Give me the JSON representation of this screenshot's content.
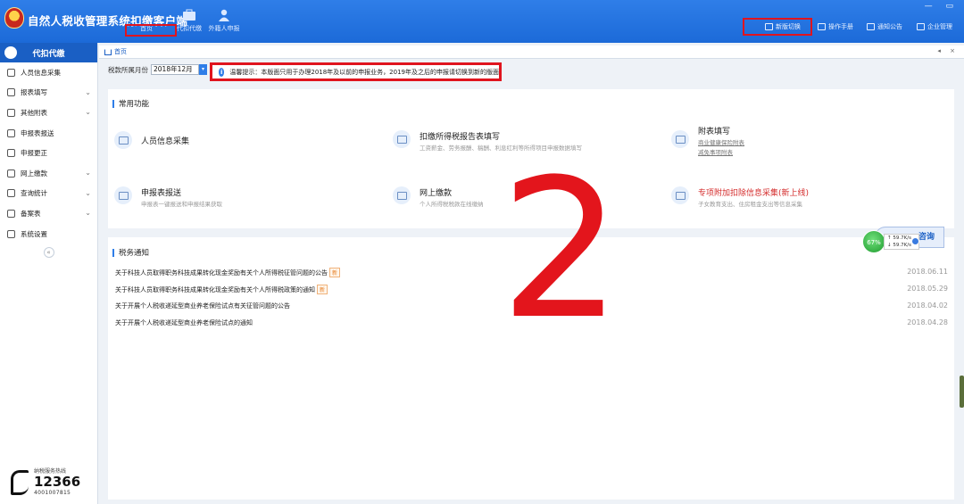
{
  "header": {
    "title": "自然人税收管理系统扣缴客户端",
    "nav": [
      {
        "label": "首页"
      },
      {
        "label": "代扣代缴"
      },
      {
        "label": "外籍人申报"
      }
    ],
    "buttons": [
      {
        "label": "新版切换"
      },
      {
        "label": "操作手册"
      },
      {
        "label": "通知公告"
      },
      {
        "label": "企业管理"
      }
    ],
    "window_controls": "— ▭"
  },
  "sidebar": {
    "title": "代扣代缴",
    "items": [
      {
        "label": "人员信息采集",
        "chevron": ""
      },
      {
        "label": "报表填写",
        "chevron": "⌄"
      },
      {
        "label": "其他附表",
        "chevron": "⌄"
      },
      {
        "label": "申报表报送",
        "chevron": ""
      },
      {
        "label": "申报更正",
        "chevron": ""
      },
      {
        "label": "网上缴款",
        "chevron": "⌄"
      },
      {
        "label": "查询统计",
        "chevron": "⌄"
      },
      {
        "label": "备案表",
        "chevron": "⌄"
      },
      {
        "label": "系统设置",
        "chevron": ""
      }
    ],
    "collapse": "«",
    "hotline": {
      "caption": "纳税服务热线",
      "number": "12366",
      "sub": "4001007815"
    }
  },
  "breadcrumb": {
    "label": "首页",
    "controls": "◂ ×"
  },
  "filter": {
    "label": "税款所属月份",
    "value": "2018年12月",
    "button": "▾"
  },
  "tip": {
    "icon": "i",
    "text": "温馨提示：本版面只用于办理2018年及以前的申报业务，2019年及之后的申报请切换到新的版面"
  },
  "common": {
    "title": "常用功能",
    "functions": [
      {
        "title": "人员信息采集",
        "desc": ""
      },
      {
        "title": "扣缴所得税报告表填写",
        "desc": "工资薪金、劳务报酬、稿酬、利息红利等所得项目申报数据填写"
      },
      {
        "title": "附表填写",
        "links": [
          "商业健康保险附表",
          "减免事项附表"
        ]
      },
      {
        "title": "申报表报送",
        "desc": "申报表一键报送和申报结果获取"
      },
      {
        "title": "网上缴款",
        "desc": "个人所得税税款在线缴纳"
      },
      {
        "title": "专项附加扣除信息采集(新上线)",
        "desc": "子女教育支出、住房租金支出等信息采集"
      }
    ]
  },
  "notices": {
    "title": "税务通知",
    "items": [
      {
        "text": "关于科技人员取得职务科技成果转化现金奖励有关个人所得税征管问题的公告",
        "new": "新",
        "date": "2018.06.11"
      },
      {
        "text": "关于科技人员取得职务科技成果转化现金奖励有关个人所得税政策的通知",
        "new": "新",
        "date": "2018.05.29"
      },
      {
        "text": "关于开展个人税收递延型商业养老保险试点有关征管问题的公告",
        "new": "",
        "date": "2018.04.02"
      },
      {
        "text": "关于开展个人税收递延型商业养老保险试点的通知",
        "new": "",
        "date": "2018.04.28"
      }
    ]
  },
  "overlay": {
    "big_number": "2",
    "consult_label": "咨询"
  },
  "speed_widget": {
    "percent": "67%",
    "up": "↑ 59.7K/s",
    "down": "↓ 59.7K/s"
  }
}
